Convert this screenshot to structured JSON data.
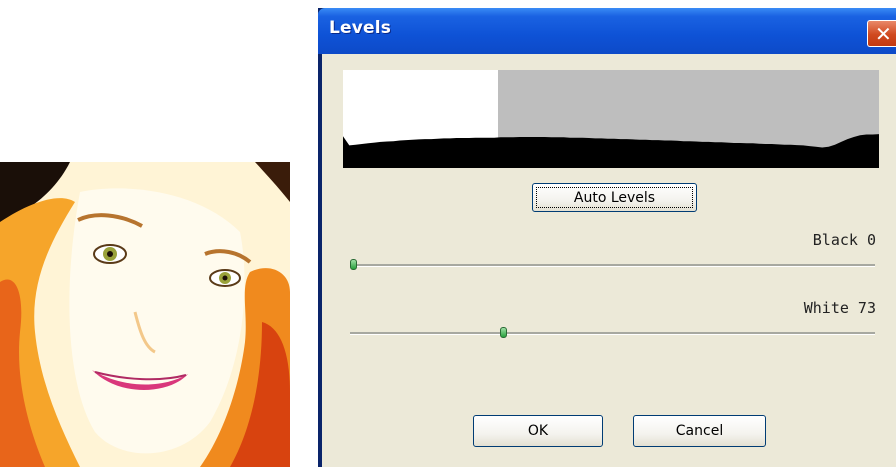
{
  "window": {
    "title": "Levels",
    "close_symbol": "✕"
  },
  "histogram": {
    "levels": [
      62,
      64,
      66,
      68,
      70,
      72,
      74,
      75,
      76,
      78,
      79,
      80,
      81,
      82,
      82,
      83,
      84,
      84,
      85,
      85,
      85,
      86,
      86,
      86,
      86,
      87,
      87,
      87,
      88,
      88,
      88,
      88,
      88,
      87,
      87,
      87,
      86,
      86,
      86,
      85,
      84,
      84,
      83,
      83,
      82,
      82,
      81,
      80,
      80,
      79,
      79,
      78,
      78,
      77,
      76,
      76,
      75,
      74,
      74,
      73,
      73,
      72,
      71,
      71,
      70,
      70,
      69,
      68,
      68,
      67,
      66,
      66,
      65,
      64,
      62,
      60,
      58,
      60,
      66,
      74,
      82,
      88,
      93,
      95,
      95,
      96
    ]
  },
  "buttons": {
    "auto_levels": "Auto Levels",
    "ok": "OK",
    "cancel": "Cancel"
  },
  "sliders": {
    "black": {
      "label": "Black 0",
      "value": 0
    },
    "white": {
      "label": "White 73",
      "value": 73
    }
  },
  "colors": {
    "title_bar": "#0e52d6",
    "dialog_bg": "#ece9d8",
    "histogram_fill": "#000000",
    "histogram_bg_selected": "#bebebe",
    "close_button": "#d0491f"
  }
}
